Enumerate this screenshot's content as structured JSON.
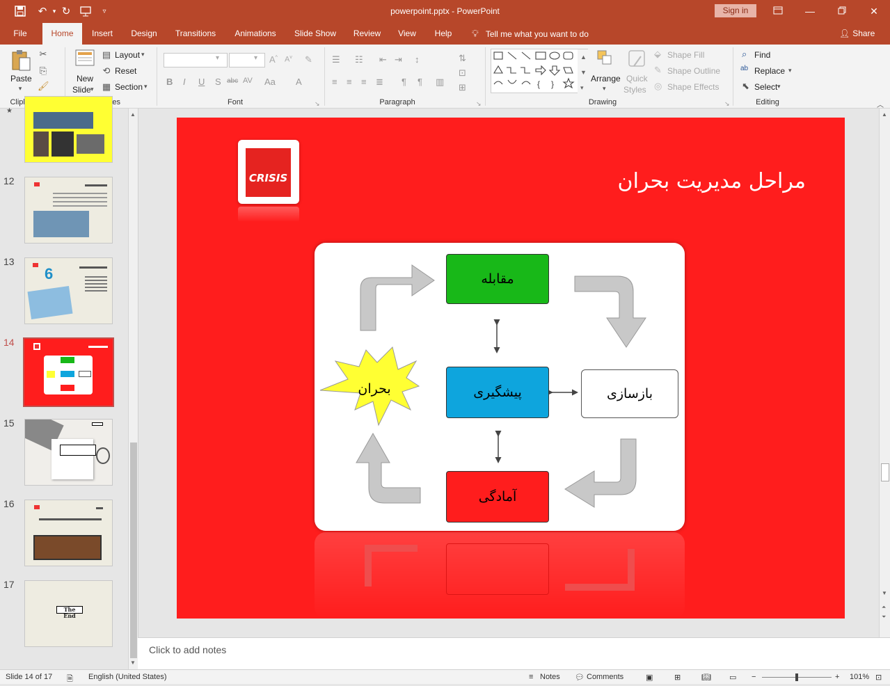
{
  "window": {
    "doc_title": "powerpoint.pptx  -  PowerPoint",
    "sign_in": "Sign in"
  },
  "tabs": [
    "File",
    "Home",
    "Insert",
    "Design",
    "Transitions",
    "Animations",
    "Slide Show",
    "Review",
    "View",
    "Help"
  ],
  "tell_me": "Tell me what you want to do",
  "share": "Share",
  "ribbon": {
    "clipboard": {
      "paste": "Paste",
      "label": "Clipboard"
    },
    "slides": {
      "new_slide_1": "New",
      "new_slide_2": "Slide",
      "layout": "Layout",
      "reset": "Reset",
      "section": "Section",
      "label": "Slides"
    },
    "font": {
      "label": "Font"
    },
    "paragraph": {
      "label": "Paragraph"
    },
    "drawing": {
      "arrange": "Arrange",
      "quick_styles_1": "Quick",
      "quick_styles_2": "Styles",
      "shape_fill": "Shape Fill",
      "shape_outline": "Shape Outline",
      "shape_effects": "Shape Effects",
      "label": "Drawing"
    },
    "editing": {
      "find": "Find",
      "replace": "Replace",
      "select": "Select",
      "label": "Editing"
    }
  },
  "slides_panel": {
    "numbers": [
      "12",
      "13",
      "14",
      "15",
      "16",
      "17"
    ],
    "active": "14",
    "thumb17_text": "The End"
  },
  "slide": {
    "title": "مراحل مدیریت بحران",
    "logo_text": "CRISIS",
    "boxes": {
      "top": "مقابله",
      "center": "پیشگیری",
      "right": "بازسازی",
      "bottom": "آمادگی",
      "star": "بحران"
    },
    "colors": {
      "background": "#ff1d1d",
      "top": "#18b818",
      "center": "#0ea5dd",
      "bottom": "#ff1d1d",
      "star": "#ffff33"
    }
  },
  "notes": "Click to add notes",
  "status": {
    "slide_info": "Slide 14 of 17",
    "language": "English (United States)",
    "notes_btn": "Notes",
    "comments_btn": "Comments",
    "zoom": "101%"
  }
}
